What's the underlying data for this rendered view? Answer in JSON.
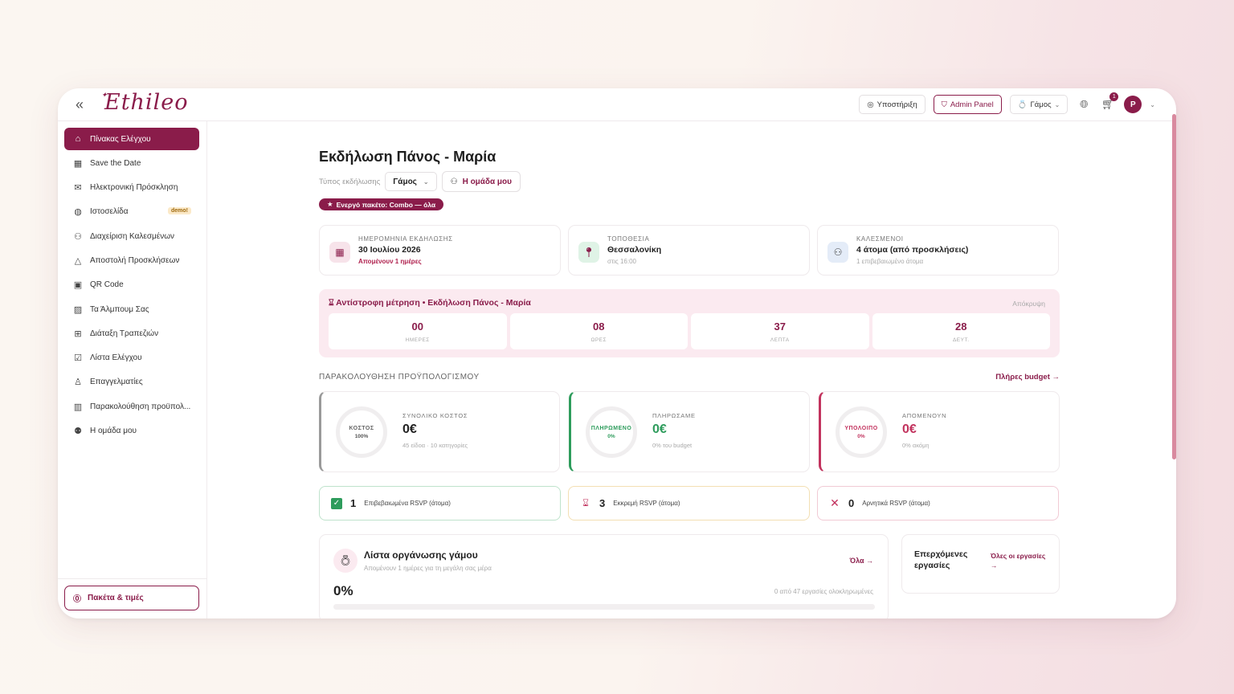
{
  "app": {
    "logo_text": "Ethileo"
  },
  "topbar": {
    "support_label": "Υποστήριξη",
    "admin_label": "Admin Panel",
    "event_type_label": "Γάμος",
    "cart_count": "1",
    "avatar_initial": "P"
  },
  "sidebar": {
    "items": [
      {
        "label": "Πίνακας Ελέγχου",
        "icon": "home-icon",
        "active": true
      },
      {
        "label": "Save the Date",
        "icon": "calendar-icon"
      },
      {
        "label": "Ηλεκτρονική Πρόσκληση",
        "icon": "mail-icon"
      },
      {
        "label": "Ιστοσελίδα",
        "icon": "globe-icon",
        "badge": "demo!"
      },
      {
        "label": "Διαχείριση Καλεσμένων",
        "icon": "users-icon"
      },
      {
        "label": "Αποστολή Προσκλήσεων",
        "icon": "send-icon"
      },
      {
        "label": "QR Code",
        "icon": "qr-icon"
      },
      {
        "label": "Τα Άλμπουμ Σας",
        "icon": "image-icon"
      },
      {
        "label": "Διάταξη Τραπεζιών",
        "icon": "grid-icon"
      },
      {
        "label": "Λίστα Ελέγχου",
        "icon": "checklist-icon"
      },
      {
        "label": "Επαγγελματίες",
        "icon": "person-icon"
      },
      {
        "label": "Παρακολούθηση προϋπολ...",
        "icon": "chart-icon"
      },
      {
        "label": "Η ομάδα μου",
        "icon": "team-icon"
      }
    ],
    "packages_label": "Πακέτα & τιμές"
  },
  "main": {
    "title": "Εκδήλωση Πάνος - Μαρία",
    "event_type_caption": "Τύπος εκδήλωσης",
    "event_type_value": "Γάμος",
    "team_button": "Η ομάδα μου",
    "active_package": "Ενεργό πακέτο: Combo — όλα",
    "info_cards": [
      {
        "label": "ΗΜΕΡΟΜΗΝΙΑ ΕΚΔΗΛΩΣΗΣ",
        "value": "30 Ιουλίου 2026",
        "sub": "Απομένουν 1 ημέρες",
        "icon": "calendar-icon"
      },
      {
        "label": "ΤΟΠΟΘΕΣΙΑ",
        "value": "Θεσσαλονίκη",
        "sub": "στις 16:00",
        "icon": "pin-icon"
      },
      {
        "label": "ΚΑΛΕΣΜΕΝΟΙ",
        "value": "4 άτομα (από προσκλήσεις)",
        "sub": "1 επιβεβαιωμένο άτομα",
        "icon": "guests-icon"
      }
    ],
    "countdown": {
      "title": "Αντίστροφη μέτρηση • Εκδήλωση Πάνος - Μαρία",
      "hide_label": "Απόκρυψη",
      "cells": [
        {
          "value": "00",
          "unit": "ΗΜΕΡΕΣ"
        },
        {
          "value": "08",
          "unit": "ΩΡΕΣ"
        },
        {
          "value": "37",
          "unit": "ΛΕΠΤΑ"
        },
        {
          "value": "28",
          "unit": "ΔΕΥΤ."
        }
      ]
    },
    "budget": {
      "heading": "ΠΑΡΑΚΟΛΟΥΘΗΣΗ ΠΡΟΫΠΟΛΟΓΙΣΜΟΥ",
      "link": "Πλήρες budget →",
      "cards": [
        {
          "ring_label": "ΚΟΣΤΟΣ",
          "ring_pct": "100%",
          "label": "ΣΥΝΟΛΙΚΟ ΚΟΣΤΟΣ",
          "value": "0€",
          "sub": "45 είδοα · 10 κατηγορίες"
        },
        {
          "ring_label": "ΠΛΗΡΩΜΕΝΟ",
          "ring_pct": "0%",
          "label": "ΠΛΗΡΩΣΑΜΕ",
          "value": "0€",
          "sub": "0% του budget"
        },
        {
          "ring_label": "ΥΠΟΛΟΙΠΟ",
          "ring_pct": "0%",
          "label": "ΑΠΟΜΕΝΟΥΝ",
          "value": "0€",
          "sub": "0% ακόμη"
        }
      ]
    },
    "rsvp": [
      {
        "count": "1",
        "label": "Επιβεβαιωμένα RSVP (άτομα)"
      },
      {
        "count": "3",
        "label": "Εκκρεμή RSVP (άτομα)"
      },
      {
        "count": "0",
        "label": "Αρνητικά RSVP (άτομα)"
      }
    ],
    "checklist": {
      "title": "Λίστα οργάνωσης γάμου",
      "sub": "Απομένουν 1 ημέρες για τη μεγάλη σας μέρα",
      "all_link": "Όλα →",
      "percent": "0%",
      "progress": 0,
      "count_text": "0 από 47 εργασίες ολοκληρωμένες"
    },
    "upcoming": {
      "title": "Επερχόμενες εργασίες",
      "link": "Όλες οι εργασίες →"
    }
  },
  "colors": {
    "brand": "#8a1c4a",
    "success": "#2e9c5c",
    "danger": "#c2335e"
  }
}
